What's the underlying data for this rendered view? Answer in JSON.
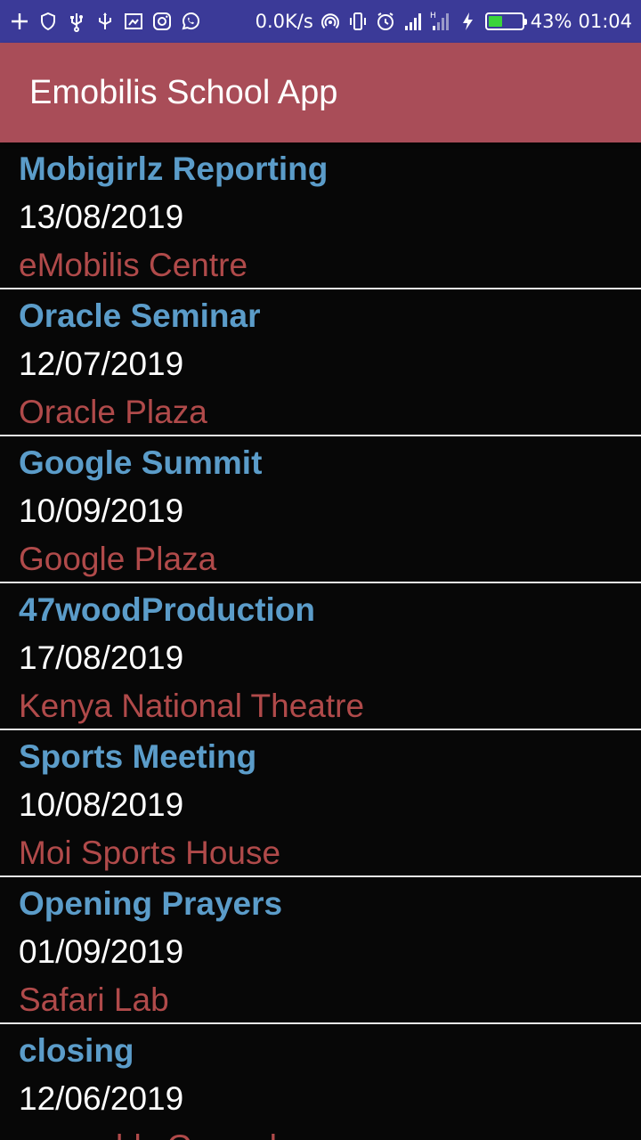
{
  "status_bar": {
    "net_speed": "0.0K/s",
    "network_type": "H",
    "battery": "43%",
    "battery_level": 0.43,
    "time": "01:04",
    "left_icons": [
      "plus-icon",
      "shield-icon",
      "usb-icon",
      "usb-alt-icon",
      "screenshot-icon",
      "instagram-icon",
      "whatsapp-icon"
    ],
    "right_icons": [
      "hotspot-icon",
      "vibrate-icon",
      "alarm-icon",
      "signal-icon",
      "signal-h-icon",
      "charging-icon",
      "battery-icon"
    ],
    "background": "#3b3a98"
  },
  "app_bar": {
    "title": "Emobilis School App",
    "background": "#a94d58"
  },
  "colors": {
    "title": "#5b9cc9",
    "date": "#ffffff",
    "venue": "#b04a4a",
    "divider": "#e8e8e8",
    "background": "#070707"
  },
  "events": [
    {
      "title": "Mobigirlz Reporting",
      "date": "13/08/2019",
      "venue": "eMobilis Centre"
    },
    {
      "title": "Oracle Seminar",
      "date": "12/07/2019",
      "venue": "Oracle Plaza"
    },
    {
      "title": "Google Summit",
      "date": "10/09/2019",
      "venue": "Google Plaza"
    },
    {
      "title": "47woodProduction",
      "date": "17/08/2019",
      "venue": "Kenya National Theatre"
    },
    {
      "title": "Sports Meeting",
      "date": "10/08/2019",
      "venue": "Moi Sports House"
    },
    {
      "title": "Opening Prayers",
      "date": "01/09/2019",
      "venue": "Safari Lab"
    },
    {
      "title": "closing",
      "date": "12/06/2019",
      "venue": "assembly Ground"
    }
  ]
}
